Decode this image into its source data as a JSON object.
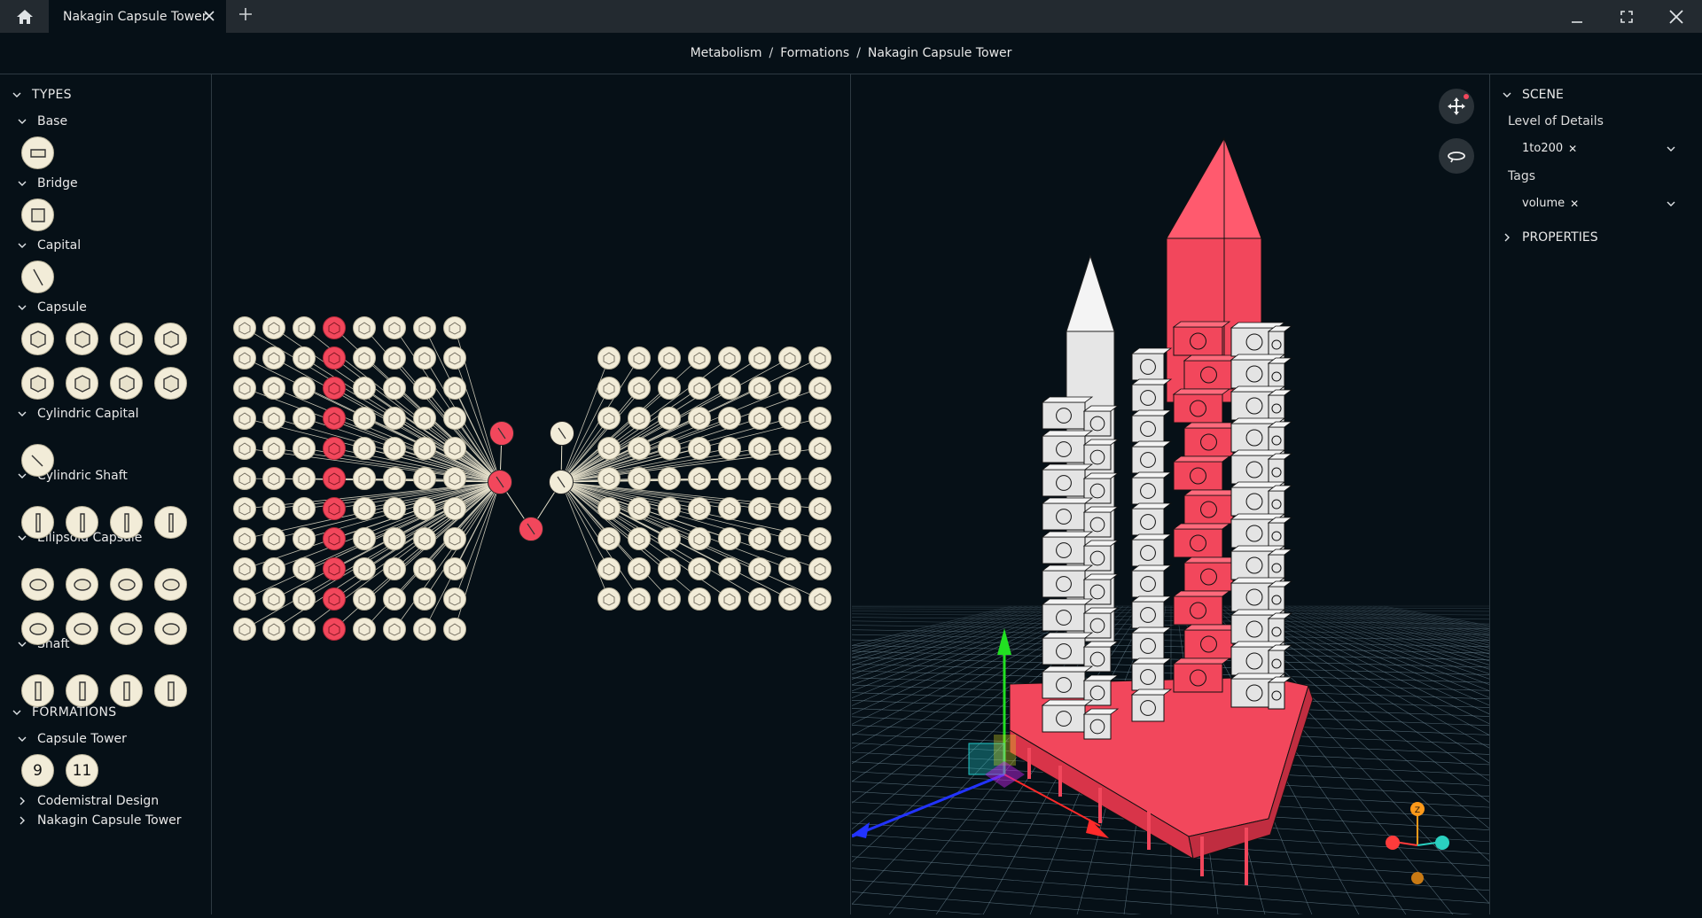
{
  "tab": {
    "title": "Nakagin Capsule Tower"
  },
  "breadcrumb": [
    "Metabolism",
    "Formations",
    "Nakagin Capsule Tower"
  ],
  "types": {
    "title": "TYPES",
    "groups": [
      {
        "name": "Base"
      },
      {
        "name": "Bridge"
      },
      {
        "name": "Capital"
      },
      {
        "name": "Capsule"
      },
      {
        "name": "Cylindric Capital"
      },
      {
        "name": "Cylindric Shaft"
      },
      {
        "name": "Ellipsoid Capsule"
      },
      {
        "name": "Shaft"
      }
    ]
  },
  "formations": {
    "title": "FORMATIONS",
    "capsule_tower": {
      "name": "Capsule Tower",
      "items": [
        "9",
        "11"
      ]
    },
    "others": [
      "Codemistral Design",
      "Nakagin Capsule Tower"
    ]
  },
  "scene": {
    "title": "SCENE",
    "lod_label": "Level of Details",
    "lod_value": "1to200",
    "tags_label": "Tags",
    "tags_value": "volume",
    "properties_title": "PROPERTIES"
  },
  "colors": {
    "accent": "#f2475c",
    "node": "#f2ecd8",
    "bg": "#061017",
    "panel": "#232a30"
  },
  "icons": [
    "home-icon",
    "close-icon",
    "plus-icon",
    "minimize-icon",
    "maximize-icon",
    "window-close-icon",
    "move-icon",
    "orbit-icon",
    "chevron-down-icon",
    "chevron-right-icon"
  ]
}
